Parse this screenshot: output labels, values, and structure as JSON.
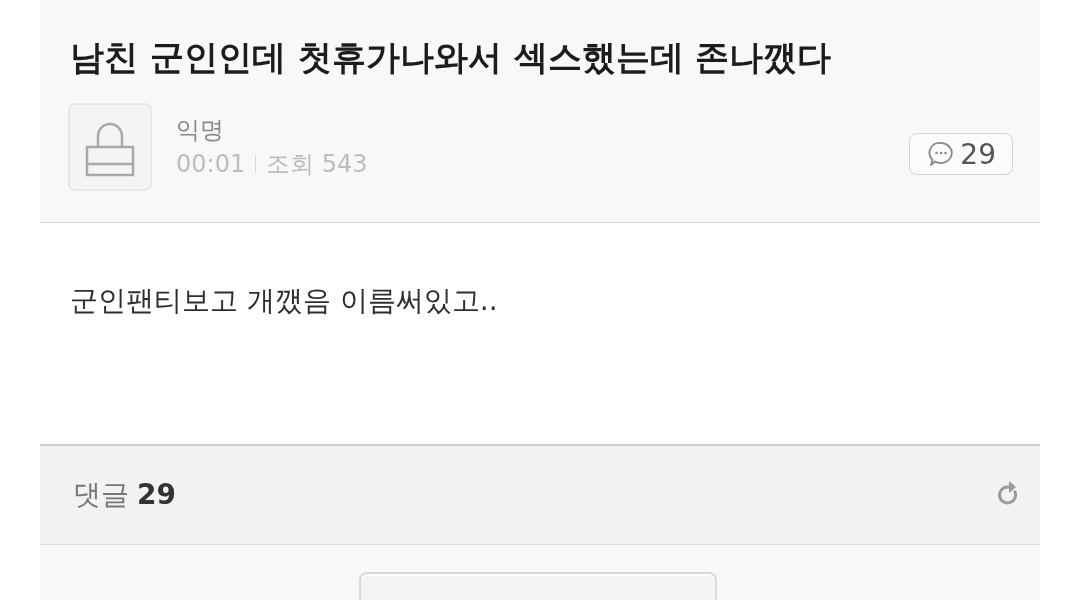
{
  "post": {
    "title": "남친 군인인데 첫휴가나와서 섹스했는데 존나깼다",
    "author": "익명",
    "time": "00:01",
    "views": "조회 543",
    "comment_count": "29",
    "body": "군인팬티보고 개깼음 이름써있고.."
  },
  "comments": {
    "label": "댓글",
    "count": "29"
  }
}
